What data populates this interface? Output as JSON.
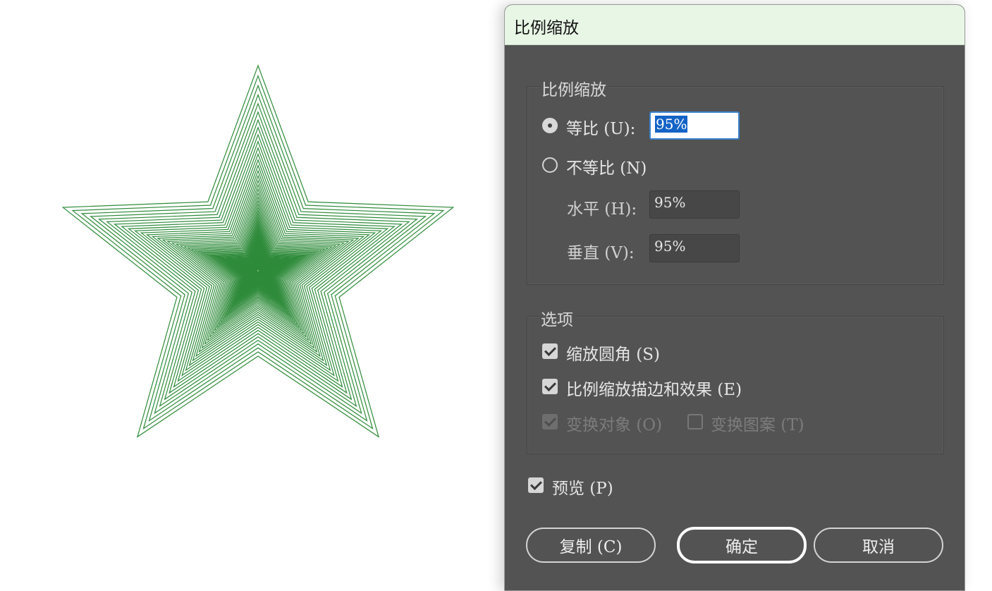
{
  "dialog": {
    "title": "比例缩放",
    "scale_group": {
      "legend": "比例缩放",
      "uniform": {
        "label": "等比 (U):",
        "value": "95%",
        "selected": true
      },
      "non_uniform": {
        "label": "不等比 (N)",
        "selected": false
      },
      "horizontal": {
        "label": "水平 (H):",
        "value": "95%"
      },
      "vertical": {
        "label": "垂直 (V):",
        "value": "95%"
      }
    },
    "options_group": {
      "legend": "选项",
      "scale_corners": {
        "label": "缩放圆角 (S)",
        "checked": true
      },
      "scale_strokes": {
        "label": "比例缩放描边和效果 (E)",
        "checked": true
      },
      "transform_objects": {
        "label": "变换对象 (O)",
        "checked": true,
        "disabled": true
      },
      "transform_patterns": {
        "label": "变换图案 (T)",
        "checked": false,
        "disabled": true
      }
    },
    "preview": {
      "label": "预览 (P)",
      "checked": true
    },
    "buttons": {
      "copy": "复制 (C)",
      "ok": "确定",
      "cancel": "取消"
    }
  },
  "artwork": {
    "shape": "nested-star",
    "stroke_color": "#2e8b3a",
    "scale_step": 0.95
  }
}
